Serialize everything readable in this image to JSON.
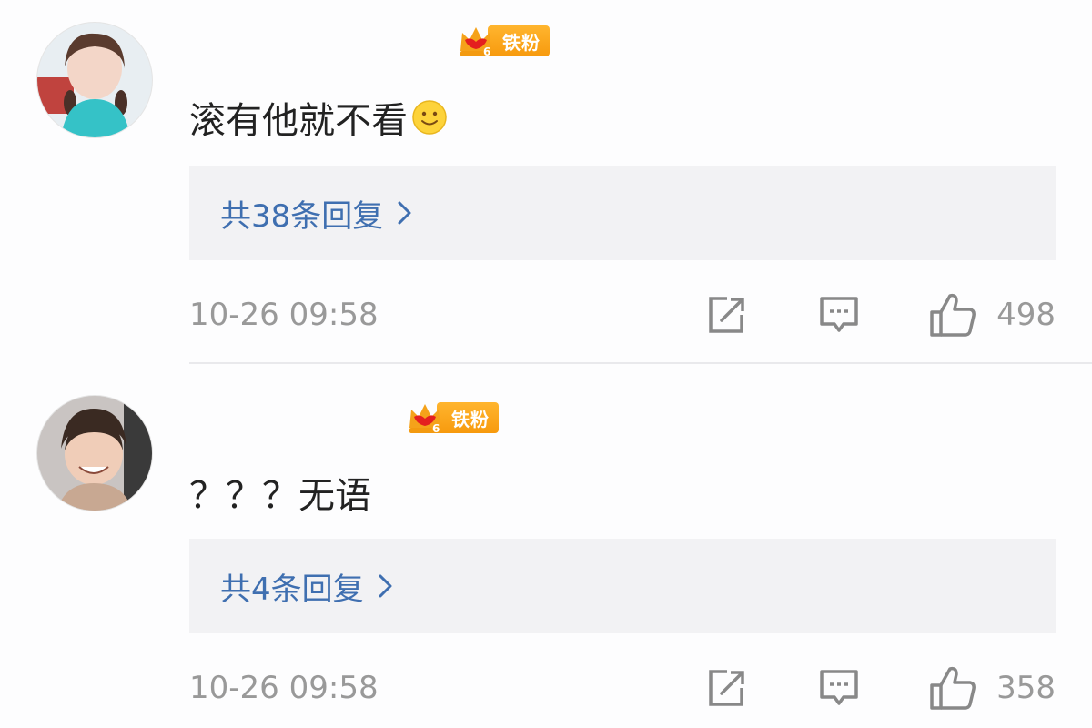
{
  "comments": [
    {
      "badge_label": "铁粉",
      "badge_level": "6",
      "text": "滚有他就不看",
      "emoji": "smiley-emoji",
      "replies_label": "共38条回复",
      "timestamp": "10-26 09:58",
      "likes": "498"
    },
    {
      "badge_label": "铁粉",
      "badge_level": "6",
      "text": "？？？无语",
      "replies_label": "共4条回复",
      "timestamp": "10-26 09:58",
      "likes": "358"
    }
  ],
  "icons": {
    "forward": "forward-icon",
    "comment": "comment-icon",
    "like": "thumbs-up-icon",
    "chevron": "chevron-right-icon"
  },
  "colors": {
    "link": "#3f6fb0",
    "badge": "#f7a21b",
    "meta": "#999999",
    "reply_bg": "#f2f2f4"
  }
}
